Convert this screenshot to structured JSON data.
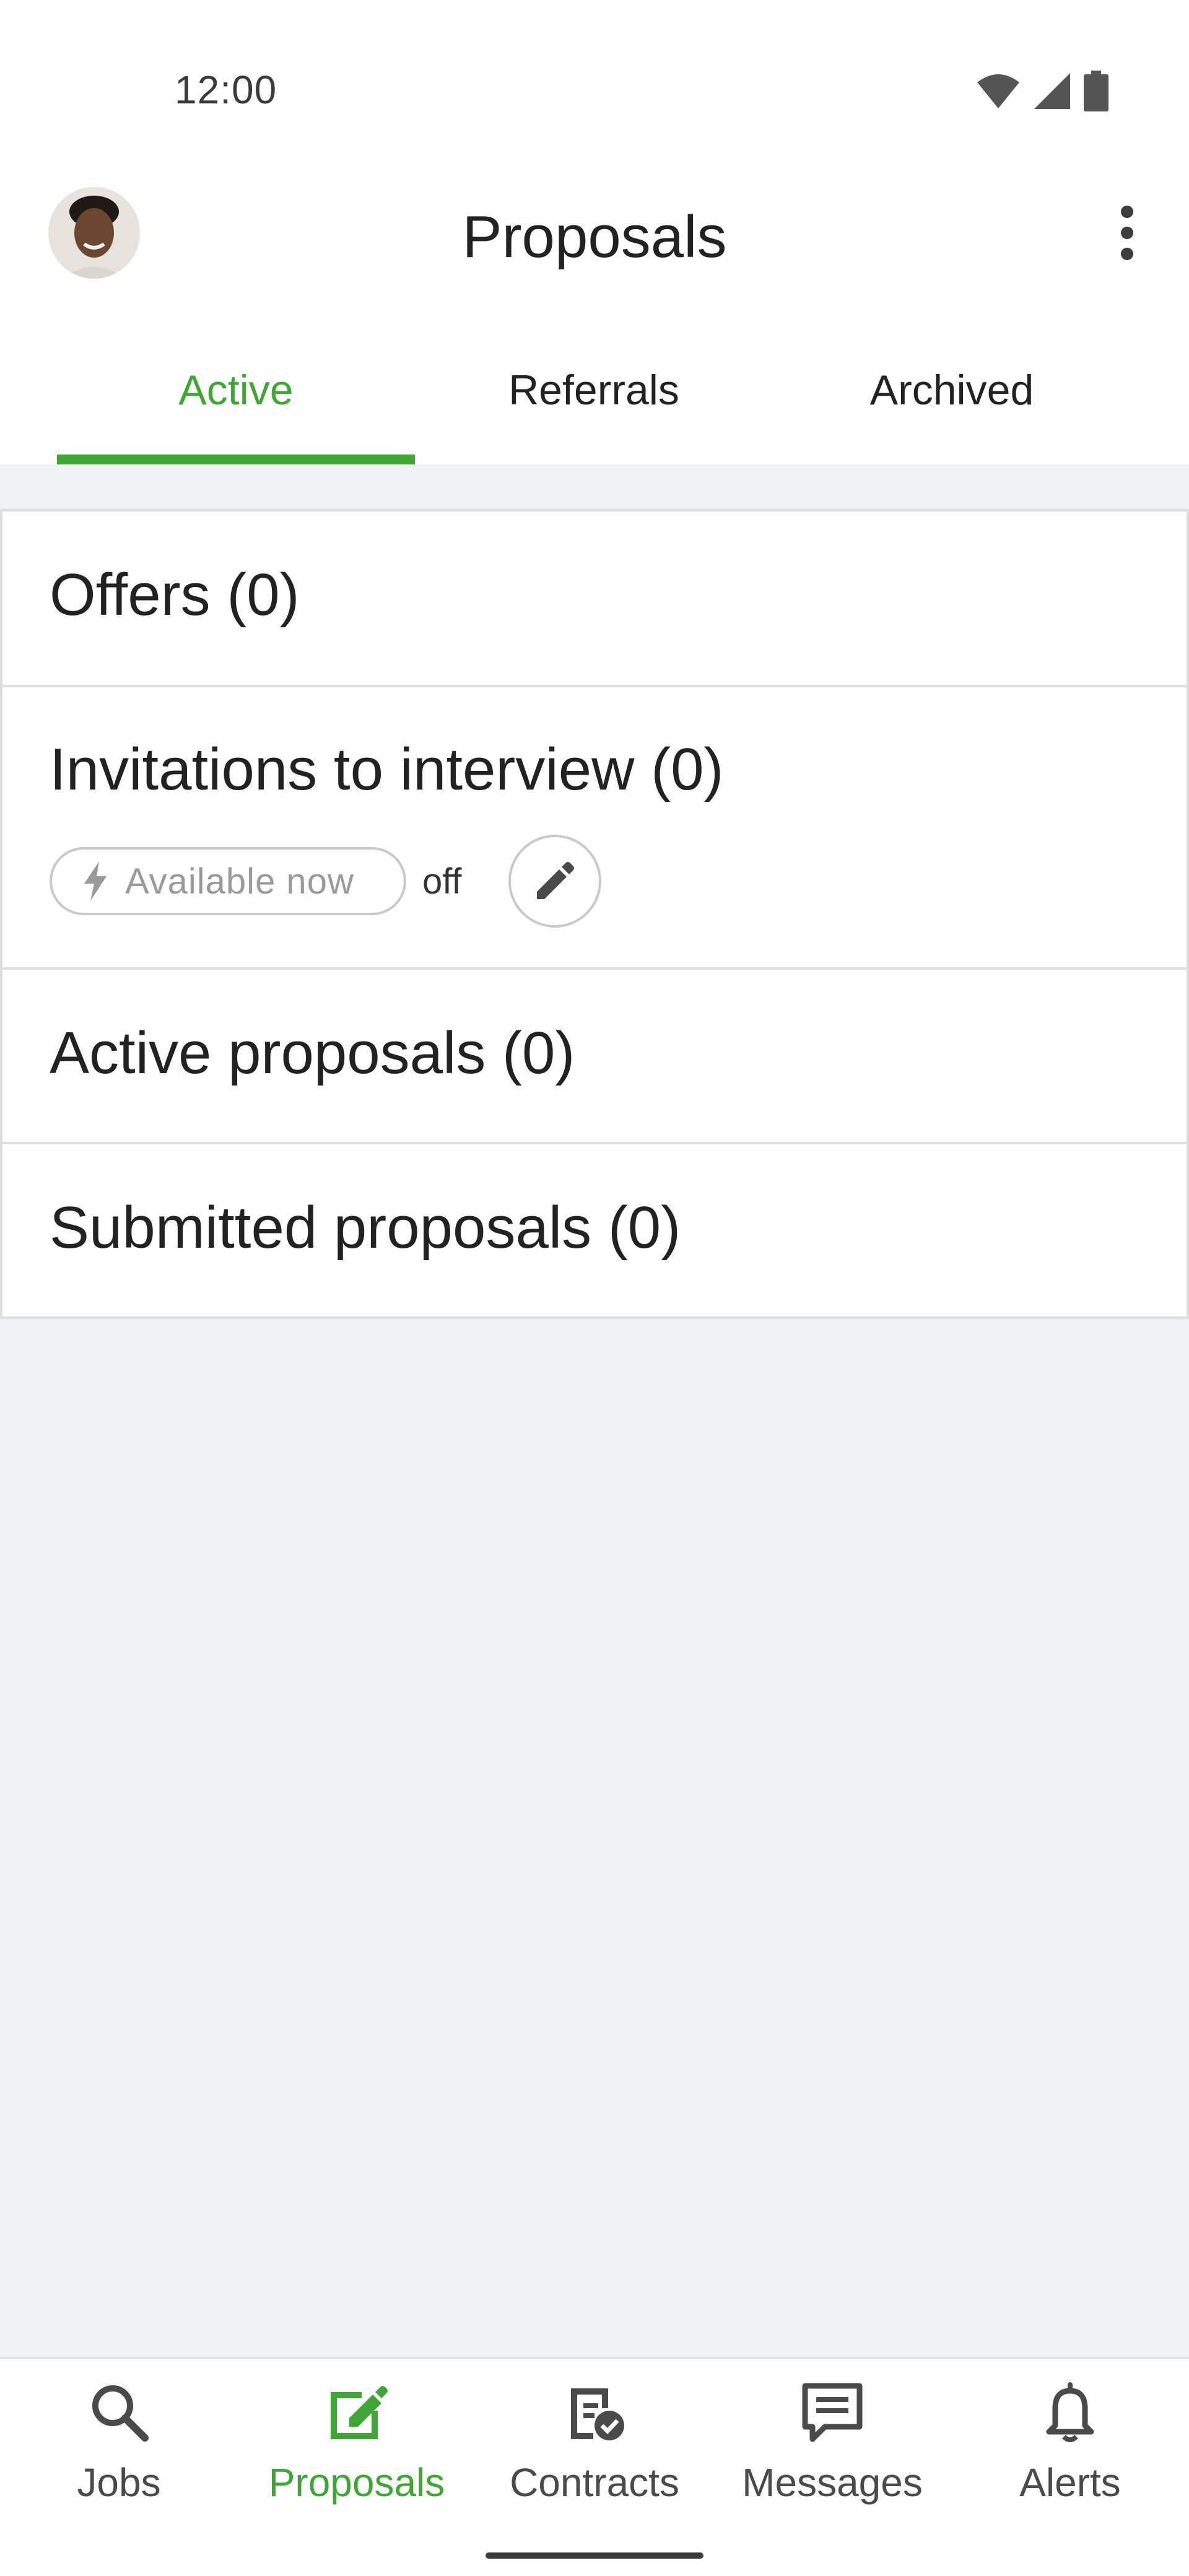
{
  "status_bar": {
    "time": "12:00",
    "icons": [
      "wifi-icon",
      "cellular-signal-icon",
      "battery-icon"
    ]
  },
  "header": {
    "title": "Proposals",
    "avatar": "profile-avatar",
    "menu_icon": "more-vertical-icon"
  },
  "tabs": [
    {
      "label": "Active",
      "selected": true
    },
    {
      "label": "Referrals",
      "selected": false
    },
    {
      "label": "Archived",
      "selected": false
    }
  ],
  "sections": {
    "offers": "Offers (0)",
    "invitations": "Invitations to interview (0)",
    "active_proposals": "Active proposals (0)",
    "submitted_proposals": "Submitted proposals (0)"
  },
  "availability": {
    "chip_label": "Available now",
    "chip_icon": "lightning-bolt-icon",
    "state": "off",
    "edit_icon": "pencil-icon"
  },
  "bottom_nav": [
    {
      "label": "Jobs",
      "icon": "search-icon",
      "active": false
    },
    {
      "label": "Proposals",
      "icon": "edit-document-icon",
      "active": true
    },
    {
      "label": "Contracts",
      "icon": "contract-check-icon",
      "active": false
    },
    {
      "label": "Messages",
      "icon": "message-icon",
      "active": false
    },
    {
      "label": "Alerts",
      "icon": "bell-icon",
      "active": false
    }
  ],
  "colors": {
    "accent": "#3fa635",
    "background": "#f0f1f3",
    "surface": "#ffffff",
    "border": "#dedede",
    "text": "#222222"
  }
}
